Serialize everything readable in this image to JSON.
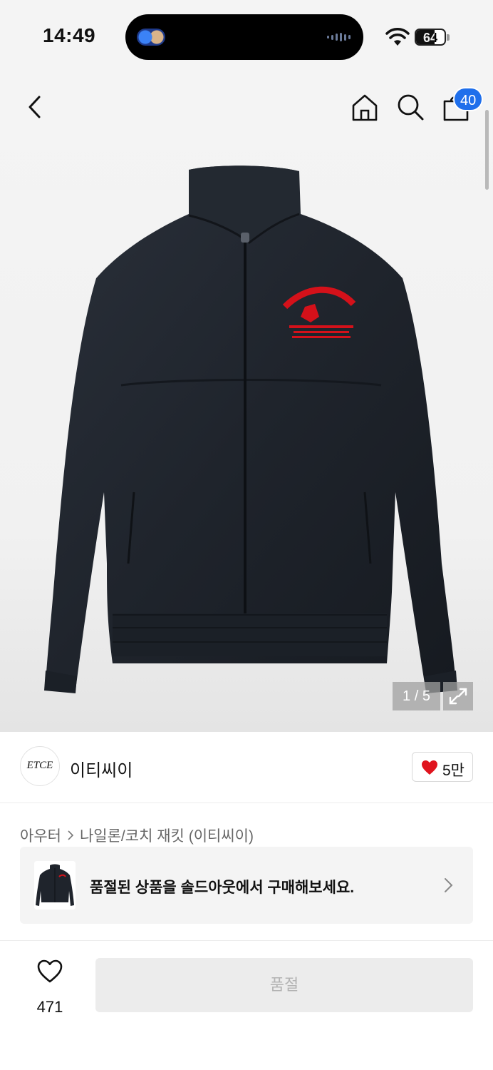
{
  "status_bar": {
    "time": "14:49",
    "battery": "64",
    "battery_level": 0.64,
    "icons": [
      "wifi-icon",
      "battery-icon"
    ]
  },
  "nav": {
    "icons": [
      "back-icon",
      "home-icon",
      "search-icon",
      "cart-icon"
    ],
    "cart_badge": "40"
  },
  "gallery": {
    "counter": "1 / 5",
    "expand_icon": "expand-icon",
    "colors": {
      "jacket": "#1f242c",
      "print": "#d4111a"
    }
  },
  "brand": {
    "logo_text": "ETCE",
    "name": "이티씨이",
    "likes": "5만",
    "like_icon": "heart-filled-icon",
    "like_color": "#e0141e"
  },
  "breadcrumb": {
    "items": [
      "아우터",
      "나일론/코치 재킷 (이티씨이)"
    ],
    "separator_icon": "chevron-right-icon"
  },
  "soldout_card": {
    "text": "품절된 상품을 솔드아웃에서 구매해보세요.",
    "chevron_icon": "chevron-right-icon"
  },
  "bottom_bar": {
    "wish_icon": "heart-outline-icon",
    "wish_count": "471",
    "buy_label": "품절"
  }
}
